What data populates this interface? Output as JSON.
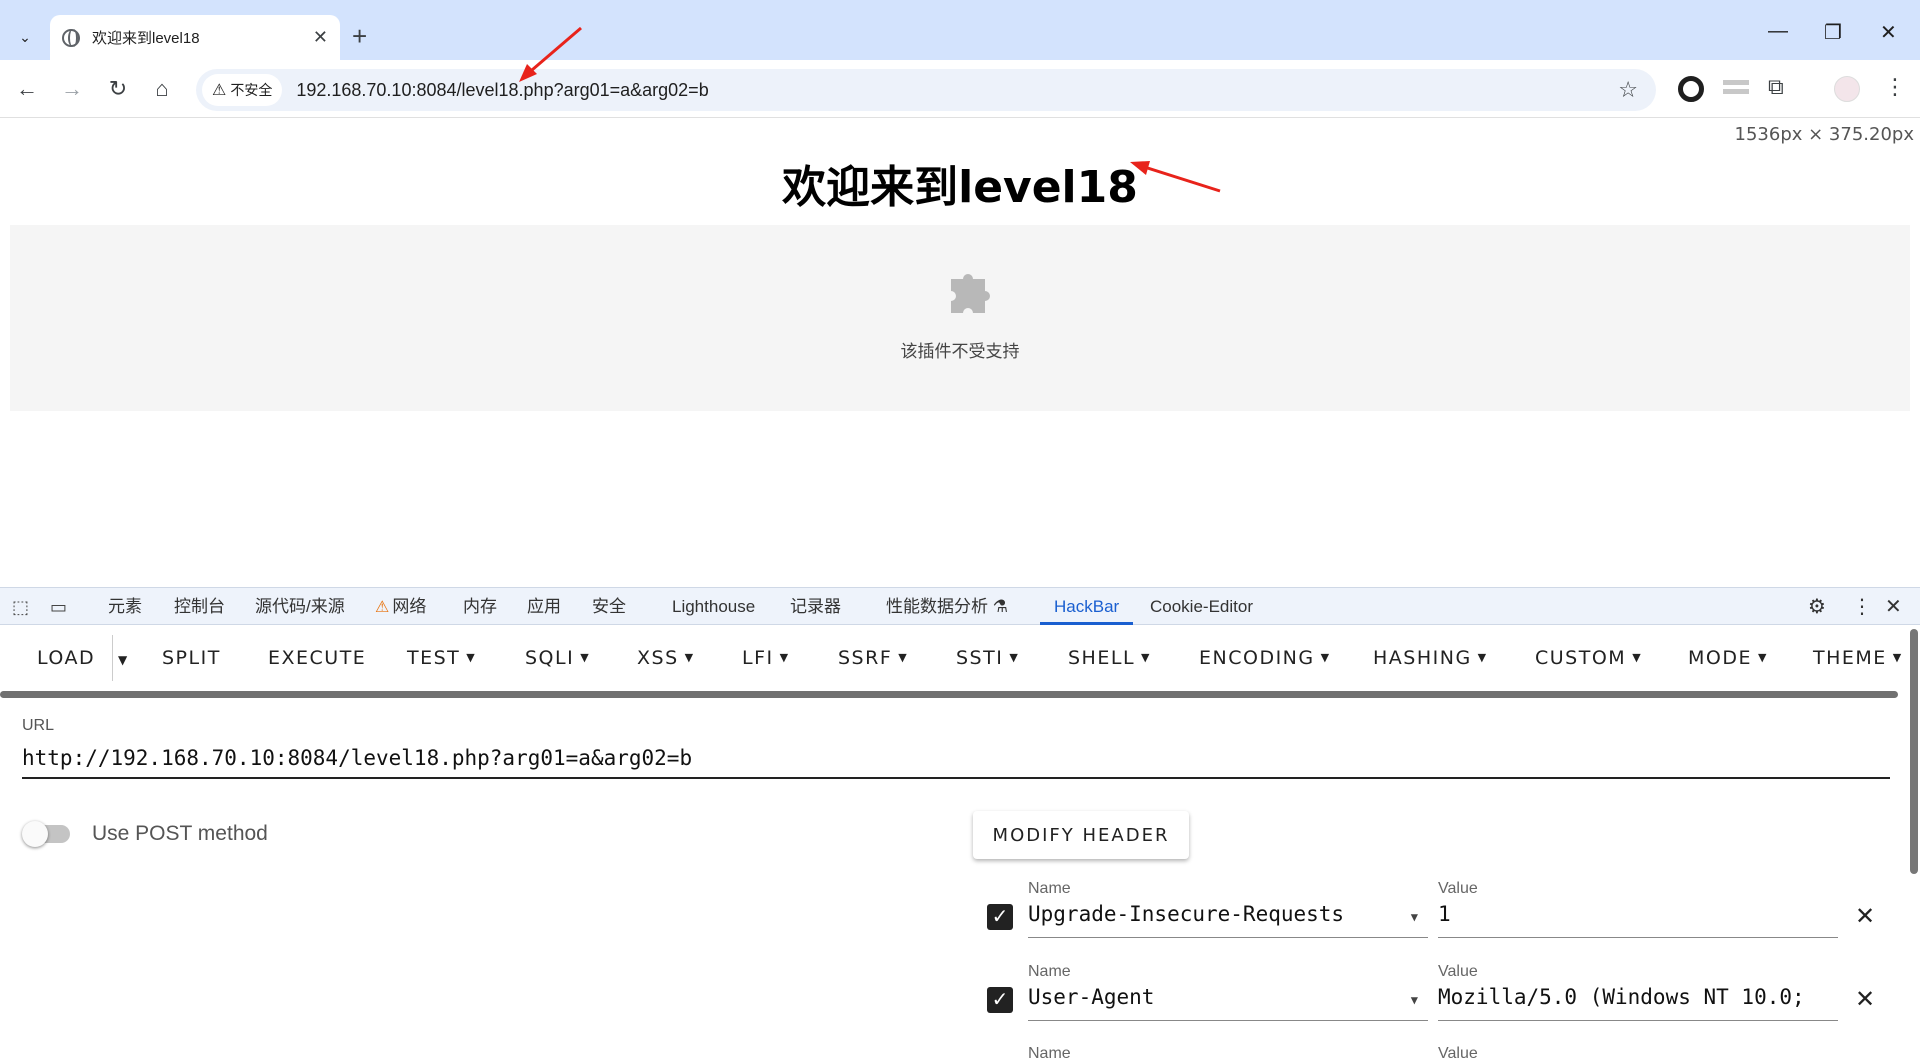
{
  "tabstrip": {
    "tab_title": "欢迎来到level18",
    "tab_close": "✕",
    "new_tab": "+",
    "search_tabs": "⌄",
    "minimize": "—",
    "restore": "❐",
    "close": "✕"
  },
  "toolbar": {
    "back": "←",
    "forward": "→",
    "reload": "↻",
    "home": "⌂",
    "security_icon": "⚠",
    "security_label": "不安全",
    "url": "192.168.70.10:8084/level18.php?arg01=a&arg02=b",
    "bookmark": "☆",
    "extensions": "⧉",
    "menu": "⋮"
  },
  "page": {
    "viewport_size": "1536px × 375.20px",
    "title": "欢迎来到level18",
    "plugin_message": "该插件不受支持"
  },
  "devtools": {
    "tabs": [
      {
        "label": "元素"
      },
      {
        "label": "控制台"
      },
      {
        "label": "源代码/来源"
      },
      {
        "label": "网络"
      },
      {
        "label": "内存"
      },
      {
        "label": "应用"
      },
      {
        "label": "安全"
      },
      {
        "label": "Lighthouse"
      },
      {
        "label": "记录器"
      },
      {
        "label": "性能数据分析 ⚗"
      },
      {
        "label": "HackBar"
      },
      {
        "label": "Cookie-Editor"
      }
    ],
    "active_tab": "HackBar",
    "settings": "⚙",
    "more": "⋮",
    "close": "✕"
  },
  "hackbar": {
    "menu": [
      {
        "label": "LOAD"
      },
      {
        "label": "SPLIT"
      },
      {
        "label": "EXECUTE"
      },
      {
        "label": "TEST"
      },
      {
        "label": "SQLI"
      },
      {
        "label": "XSS"
      },
      {
        "label": "LFI"
      },
      {
        "label": "SSRF"
      },
      {
        "label": "SSTI"
      },
      {
        "label": "SHELL"
      },
      {
        "label": "ENCODING"
      },
      {
        "label": "HASHING"
      },
      {
        "label": "CUSTOM"
      },
      {
        "label": "MODE"
      },
      {
        "label": "THEME"
      }
    ],
    "url_label": "URL",
    "url_value": "http://192.168.70.10:8084/level18.php?arg01=a&arg02=b",
    "post_label": "Use POST method",
    "post_enabled": false,
    "modify_header": "MODIFY HEADER",
    "headers": [
      {
        "name_label": "Name",
        "name": "Upgrade-Insecure-Requests",
        "value_label": "Value",
        "value": "1",
        "checked": true
      },
      {
        "name_label": "Name",
        "name": "User-Agent",
        "value_label": "Value",
        "value": "Mozilla/5.0 (Windows NT 10.0;",
        "checked": true
      },
      {
        "name_label": "Name",
        "name": "",
        "value_label": "Value",
        "value": "",
        "checked": true
      }
    ]
  },
  "colors": {
    "tabstrip_bg": "#d3e3fd",
    "omnibox_bg": "#edf2fa",
    "devtools_active": "#1a5fd0",
    "annotation_arrow": "#e8231b"
  }
}
